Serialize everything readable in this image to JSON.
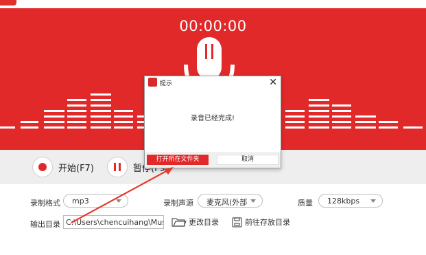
{
  "theme": {
    "accent": "#e2292a",
    "controls_bg": "#eeeeee"
  },
  "header": {
    "timer": "00:00:00"
  },
  "controls": {
    "start_label": "开始(F7)",
    "pause_label": "暂停(F9)"
  },
  "settings": {
    "format_label": "录制格式",
    "format_value": "mp3",
    "source_label": "录制声源",
    "source_value": "麦克风(外部",
    "quality_label": "质量",
    "quality_value": "128kbps",
    "output_label": "输出目录",
    "output_path": "C:\\Users\\chencuihang\\Music",
    "change_dir_label": "更改目录",
    "open_dir_label": "前往存放目录"
  },
  "dialog": {
    "title": "提示",
    "message": "录音已经完成!",
    "open_folder_label": "打开所在文件夹",
    "cancel_label": "取消",
    "close_glyph": "✕"
  },
  "icons": [
    "app-icon",
    "microphone-icon",
    "record-icon",
    "pause-icon",
    "folder-icon",
    "save-icon",
    "close-icon",
    "dropdown-caret-icon"
  ]
}
